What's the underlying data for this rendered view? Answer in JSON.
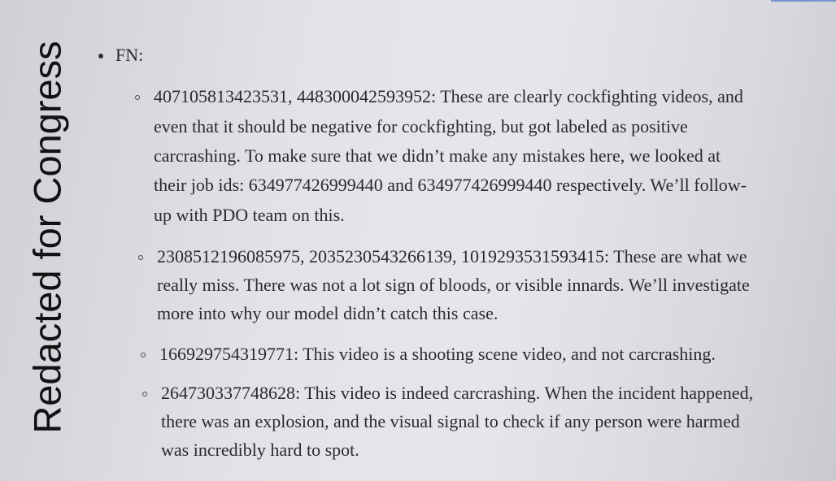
{
  "watermark": "Redacted for Congress",
  "section": {
    "label": "FN:"
  },
  "items": [
    {
      "lines": [
        "407105813423531, 448300042593952: These are clearly cockfighting videos, and",
        "even that it should be negative for cockfighting, but got labeled as positive",
        "carcrashing. To make sure that we didn’t make any mistakes here, we looked at",
        "their job ids: 634977426999440 and 634977426999440 respectively. We’ll follow-",
        "up with PDO team on this."
      ]
    },
    {
      "lines": [
        "2308512196085975, 2035230543266139, 1019293531593415: These are what we",
        "really miss. There was not a lot sign of bloods, or visible innards. We’ll investigate",
        "more into why our model didn’t catch this case."
      ]
    },
    {
      "lines": [
        "166929754319771: This video is a shooting scene video, and not carcrashing."
      ]
    },
    {
      "lines": [
        "264730337748628: This video is indeed carcrashing. When the incident happened,",
        "there was an explosion, and the visual signal to check if any person were harmed",
        "was incredibly hard to spot."
      ]
    }
  ]
}
